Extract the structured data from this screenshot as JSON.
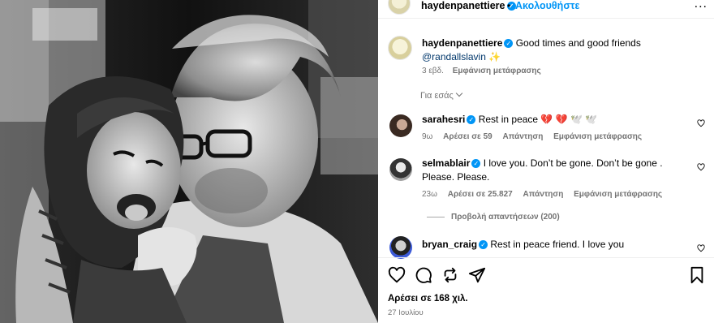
{
  "post": {
    "author": "haydenpanettiere",
    "follow_label": "Ακολουθήστε",
    "dot": "•",
    "more": "...",
    "caption_text": "Good times and good friends",
    "caption_mention": "@randallslavin",
    "caption_emoji": "✨",
    "caption_age": "3 εβδ.",
    "translate_label": "Εμφάνιση μετάφρασης",
    "for_you_label": "Για εσάς",
    "likes_label": "Αρέσει σε 168 χιλ.",
    "date_label": "27 Ιουλίου"
  },
  "comments": [
    {
      "username": "sarahesri",
      "text": "Rest in peace 💔 💔 🕊️ 🕊️",
      "age": "9ω",
      "likes": "Αρέσει σε 59",
      "reply": "Απάντηση",
      "translate": "Εμφάνιση μετάφρασης"
    },
    {
      "username": "selmablair",
      "text": "I love you. Don’t be gone. Don’t be gone . Please. Please.",
      "age": "23ω",
      "likes": "Αρέσει σε 25.827",
      "reply": "Απάντηση",
      "translate": "Εμφάνιση μετάφρασης",
      "view_replies": "Προβολή απαντήσεων (200)"
    },
    {
      "username": "bryan_craig",
      "text": "Rest in peace friend. I love you"
    }
  ],
  "icons": {
    "verified": "verified-badge-icon",
    "heart": "heart-icon",
    "comment": "comment-icon",
    "share": "share-icon",
    "repost": "repost-icon",
    "save": "bookmark-icon"
  },
  "colors": {
    "accent": "#0095f6",
    "muted": "#737373",
    "mention": "#00376b"
  }
}
